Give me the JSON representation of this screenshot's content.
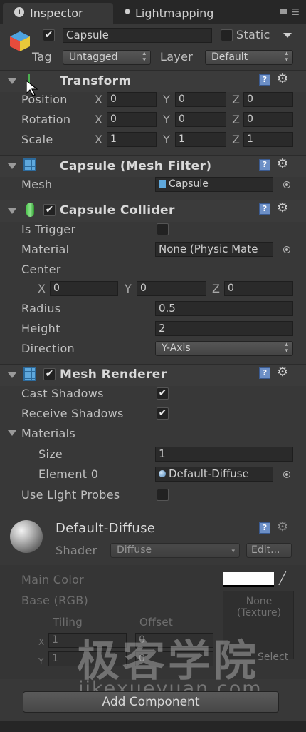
{
  "tabs": [
    {
      "label": "Inspector",
      "icon": "info-icon"
    },
    {
      "label": "Lightmapping",
      "icon": "bulb-icon"
    }
  ],
  "object": {
    "name": "Capsule",
    "active": true,
    "static_label": "Static",
    "static": false,
    "tag_label": "Tag",
    "tag_value": "Untagged",
    "layer_label": "Layer",
    "layer_value": "Default"
  },
  "transform": {
    "title": "Transform",
    "position_label": "Position",
    "rotation_label": "Rotation",
    "scale_label": "Scale",
    "axis_x": "X",
    "axis_y": "Y",
    "axis_z": "Z",
    "position": {
      "x": "0",
      "y": "0",
      "z": "0"
    },
    "rotation": {
      "x": "0",
      "y": "0",
      "z": "0"
    },
    "scale": {
      "x": "1",
      "y": "1",
      "z": "1"
    }
  },
  "mesh_filter": {
    "title": "Capsule (Mesh Filter)",
    "mesh_label": "Mesh",
    "mesh_value": "Capsule"
  },
  "collider": {
    "title": "Capsule Collider",
    "enabled": true,
    "is_trigger_label": "Is Trigger",
    "is_trigger": false,
    "material_label": "Material",
    "material_value": "None (Physic Mate",
    "center_label": "Center",
    "center": {
      "x": "0",
      "y": "0",
      "z": "0"
    },
    "radius_label": "Radius",
    "radius": "0.5",
    "height_label": "Height",
    "height": "2",
    "direction_label": "Direction",
    "direction": "Y-Axis"
  },
  "renderer": {
    "title": "Mesh Renderer",
    "enabled": true,
    "cast_shadows_label": "Cast Shadows",
    "cast_shadows": true,
    "receive_shadows_label": "Receive Shadows",
    "receive_shadows": true,
    "materials_label": "Materials",
    "size_label": "Size",
    "size": "1",
    "element0_label": "Element 0",
    "element0_value": "Default-Diffuse",
    "light_probes_label": "Use Light Probes",
    "light_probes": false
  },
  "material": {
    "name": "Default-Diffuse",
    "shader_label": "Shader",
    "shader_value": "Diffuse",
    "edit_button": "Edit...",
    "main_color_label": "Main Color",
    "base_label": "Base (RGB)",
    "texture_value": "None (Texture)",
    "tiling_label": "Tiling",
    "offset_label": "Offset",
    "tiling_x": "1",
    "tiling_y": "1",
    "offset_x": "0",
    "offset_y": "0",
    "select_button": "Select",
    "main_color": "#ffffff"
  },
  "watermark": {
    "cn": "极客学院",
    "url": "jikexueyuan.com"
  },
  "add_component": "Add Component",
  "colors": {
    "bg": "#383838",
    "field": "#2a2a2a",
    "help": "#6c8fc6"
  }
}
